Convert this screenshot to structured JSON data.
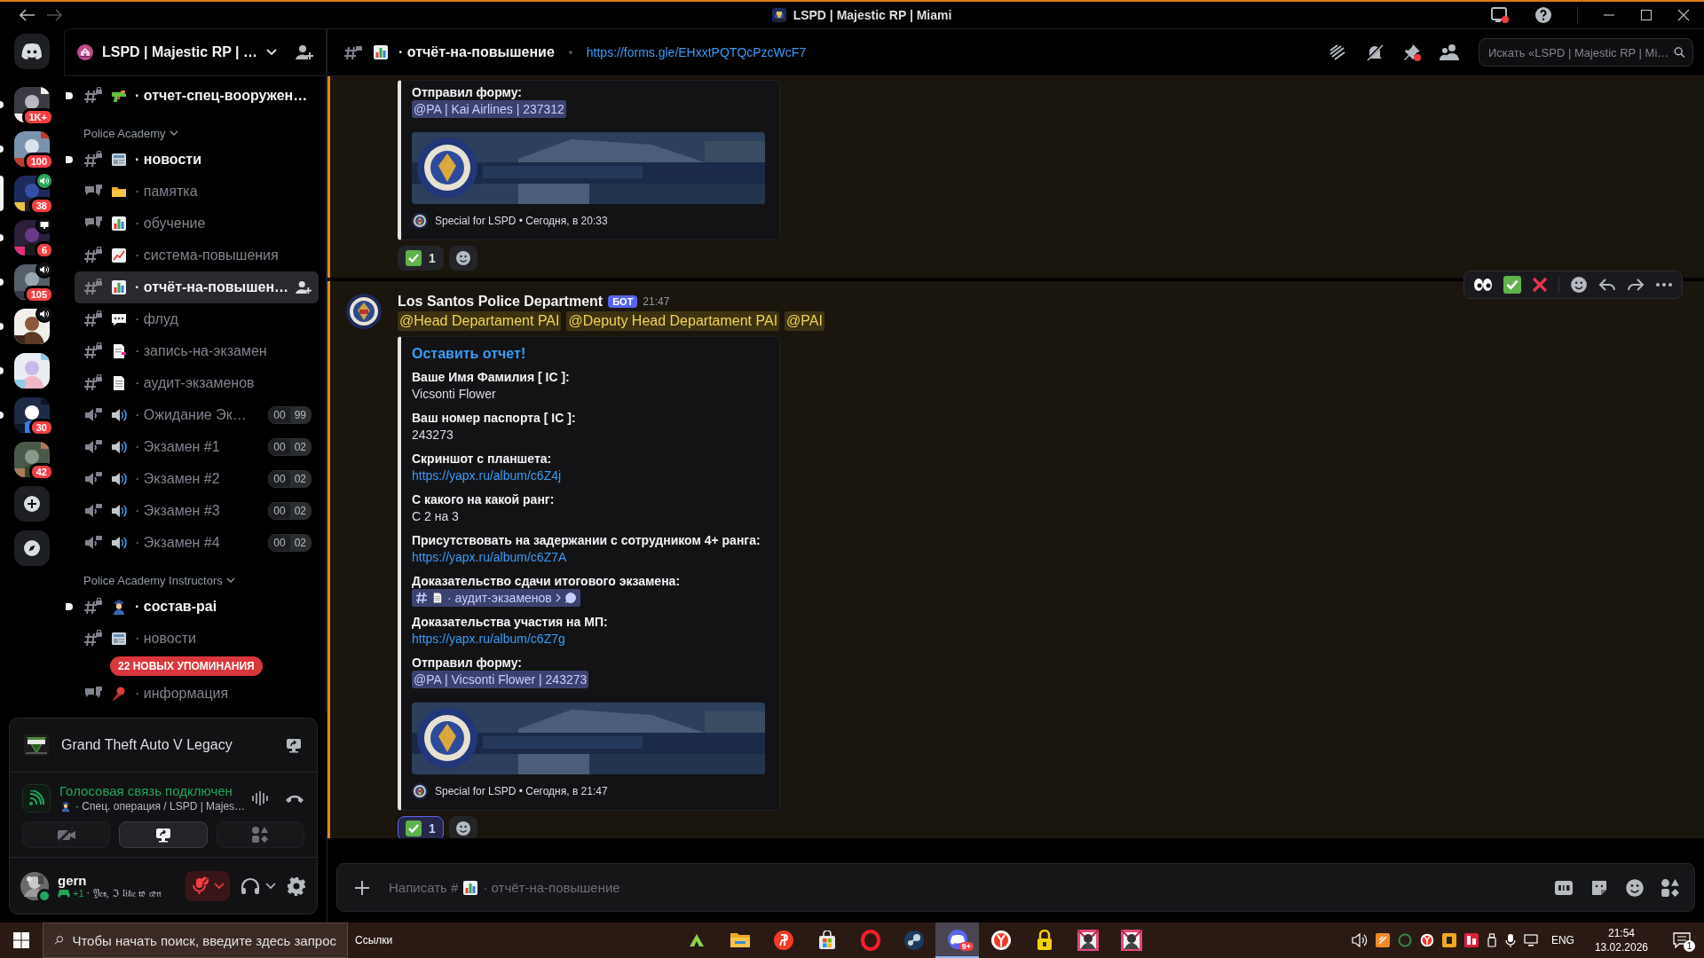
{
  "window": {
    "title": "LSPD | Majestic RP | Miami"
  },
  "servers": [
    {
      "badge": "1K+",
      "unread": true,
      "selected": false
    },
    {
      "badge": "100",
      "unread": true,
      "selected": false
    },
    {
      "badge": "38",
      "selected": true,
      "activity": {
        "kind": "speaking"
      }
    },
    {
      "badge": "6",
      "unread": true,
      "selected": false,
      "activity": {
        "kind": "screen"
      }
    },
    {
      "badge": "105",
      "unread": true,
      "selected": false,
      "activity": {
        "kind": "voice"
      }
    },
    {
      "unread": true,
      "selected": false,
      "activity": {
        "kind": "voice"
      }
    },
    {
      "unread": true,
      "selected": false
    },
    {
      "badge": "30",
      "unread": true,
      "selected": false
    },
    {
      "badge": "42",
      "unread": false,
      "selected": false
    }
  ],
  "server_header": {
    "name": "LSPD | Majestic RP | …"
  },
  "sidebar": {
    "items": [
      {
        "kind": "text",
        "emoji": {
          "kind": "gun"
        },
        "name": "· отчет-спец-вооружен…",
        "unread": true,
        "selected": false
      },
      {
        "kind": "category",
        "label": "Police Academy",
        "expanded": true
      },
      {
        "kind": "text",
        "emoji": {
          "kind": "newspaper"
        },
        "name": "· новости",
        "unread": true,
        "selected": false
      },
      {
        "kind": "forum",
        "emoji": {
          "kind": "folder"
        },
        "name": "· памятка",
        "unread": false,
        "selected": false
      },
      {
        "kind": "forum",
        "emoji": {
          "kind": "chart"
        },
        "name": "· обучение",
        "unread": false,
        "selected": false
      },
      {
        "kind": "text",
        "emoji": {
          "kind": "trend"
        },
        "name": "· система-повышения",
        "unread": false,
        "selected": false
      },
      {
        "kind": "text",
        "emoji": {
          "kind": "chart"
        },
        "name": "· отчёт-на-повышен…",
        "unread": false,
        "selected": true
      },
      {
        "kind": "text",
        "emoji": {
          "kind": "speech"
        },
        "name": "· флуд",
        "unread": false,
        "selected": false
      },
      {
        "kind": "text",
        "emoji": {
          "kind": "docpen"
        },
        "name": "· запись-на-экзамен",
        "unread": false,
        "selected": false
      },
      {
        "kind": "text",
        "emoji": {
          "kind": "doc"
        },
        "name": "· аудит-экзаменов",
        "unread": false,
        "selected": false
      },
      {
        "kind": "voice",
        "emoji": {
          "kind": "speaker"
        },
        "name": "· Ожидание Эк…",
        "count": "00",
        "limit": "99",
        "unread": false,
        "selected": false
      },
      {
        "kind": "voice",
        "emoji": {
          "kind": "speaker"
        },
        "name": "· Экзамен #1",
        "count": "00",
        "limit": "02",
        "unread": false,
        "selected": false
      },
      {
        "kind": "voice",
        "emoji": {
          "kind": "speaker"
        },
        "name": "· Экзамен #2",
        "count": "00",
        "limit": "02",
        "unread": false,
        "selected": false
      },
      {
        "kind": "voice",
        "emoji": {
          "kind": "speaker"
        },
        "name": "· Экзамен #3",
        "count": "00",
        "limit": "02",
        "unread": false,
        "selected": false
      },
      {
        "kind": "voice",
        "emoji": {
          "kind": "speaker"
        },
        "name": "· Экзамен #4",
        "count": "00",
        "limit": "02",
        "unread": false,
        "selected": false
      },
      {
        "kind": "category",
        "label": "Police Academy Instructors",
        "expanded": true
      },
      {
        "kind": "text",
        "emoji": {
          "kind": "police"
        },
        "name": "· состав-pai",
        "unread": true,
        "selected": false
      },
      {
        "kind": "text",
        "emoji": {
          "kind": "newspaper"
        },
        "name": "· новости",
        "unread": false,
        "selected": false
      },
      {
        "kind": "forum",
        "emoji": {
          "kind": "pin"
        },
        "name": "· информация",
        "unread": false,
        "selected": false
      }
    ],
    "mentions_pill": "22 НОВЫХ УПОМИНАНИЯ"
  },
  "activity": {
    "game": "Grand Theft Auto V Legacy"
  },
  "voice": {
    "status": "Голосовая связь подключен",
    "channel_emoji": {
      "kind": "police"
    },
    "channel": "· Спец. операция / LSPD | Majes…",
    "buttons": [
      {
        "kind": "camera",
        "selected": false
      },
      {
        "kind": "screen",
        "selected": true
      },
      {
        "kind": "activities",
        "selected": false
      }
    ]
  },
  "user": {
    "name": "gern",
    "status": {
      "kind": "online"
    },
    "activity_count": "+1",
    "custom_status": "· 𝔜𝔢𝔰, ℑ 𝔩𝔦𝔨𝔢 𝔱𝔬 𝔠𝔬𝔫",
    "muted": true
  },
  "channel_header": {
    "emoji": {
      "kind": "chart"
    },
    "name": "· отчёт-на-повышение",
    "topic": "https://forms.gle/EHxxtPQTQcPzcWcF7",
    "search_placeholder": "Искать «LSPD | Majestic RP | Mi…"
  },
  "messages": [
    {
      "kind": "continuation",
      "highlighted": true,
      "embed": {
        "fields": [
          {
            "label": "Отправил форму:",
            "value": {
              "kind": "mention",
              "text": "@PA | Kai Airlines | 237312"
            }
          }
        ],
        "image": {
          "kind": "picture"
        },
        "footer": "Special for LSPD • Сегодня, в 20:33"
      },
      "reactions": [
        {
          "count": "1",
          "selected": false
        }
      ]
    },
    {
      "kind": "full",
      "highlighted": true,
      "author": "Los Santos Police Department",
      "tag": "БОТ",
      "time": "21:47",
      "mentions": [
        "@Head Departament PAI",
        "@Deputy Head Departament PAI",
        "@PAI"
      ],
      "embed": {
        "title": "Оставить отчет!",
        "fields": [
          {
            "label": "Ваше Имя Фамилия [ IC ]:",
            "value": {
              "kind": "text",
              "text": "Vicsonti Flower"
            }
          },
          {
            "label": "Ваш номер паспорта [ IC ]:",
            "value": {
              "kind": "text",
              "text": "243273"
            }
          },
          {
            "label": "Скриншот с планшета:",
            "value": {
              "kind": "link",
              "text": "https://yapx.ru/album/c6Z4j"
            }
          },
          {
            "label": "С какого на какой ранг:",
            "value": {
              "kind": "text",
              "text": "С 2 на 3"
            }
          },
          {
            "label": "Присутствовать на задержании с сотрудником 4+ ранга:",
            "value": {
              "kind": "link",
              "text": "https://yapx.ru/album/c6Z7A"
            }
          },
          {
            "label": "Доказательство сдачи итогового экзамена:",
            "value": {
              "kind": "channel",
              "emoji": {
                "kind": "doc"
              },
              "text": "· аудит-экзаменов"
            }
          },
          {
            "label": "Доказательства участия на МП:",
            "value": {
              "kind": "link",
              "text": "https://yapx.ru/album/c6Z7g"
            }
          },
          {
            "label": "Отправил форму:",
            "value": {
              "kind": "mention",
              "text": "@PA | Vicsonti Flower | 243273"
            }
          }
        ],
        "image": {
          "kind": "picture"
        },
        "footer": "Special for LSPD • Сегодня, в 21:47"
      },
      "reactions": [
        {
          "count": "1",
          "selected": true
        }
      ]
    }
  ],
  "composer": {
    "placeholder": "Написать #",
    "channel": "· отчёт-на-повышение"
  },
  "taskbar": {
    "search_placeholder": "Чтобы начать поиск, введите здесь запрос",
    "toolbar": "Ссылки",
    "apps": [
      {
        "kind": "launcher",
        "active": false
      },
      {
        "kind": "folder",
        "active": false
      },
      {
        "kind": "yandex",
        "active": false
      },
      {
        "kind": "store",
        "active": false
      },
      {
        "kind": "opera",
        "active": false
      },
      {
        "kind": "steam",
        "active": false
      },
      {
        "kind": "discord",
        "active": true,
        "badge": "9+"
      },
      {
        "kind": "browser",
        "active": false
      },
      {
        "kind": "lock",
        "active": false
      },
      {
        "kind": "picture",
        "active": false
      },
      {
        "kind": "picture",
        "active": false
      }
    ],
    "language": "ENG",
    "time": "21:54",
    "date": "13.02.2026",
    "notifications": "1"
  }
}
